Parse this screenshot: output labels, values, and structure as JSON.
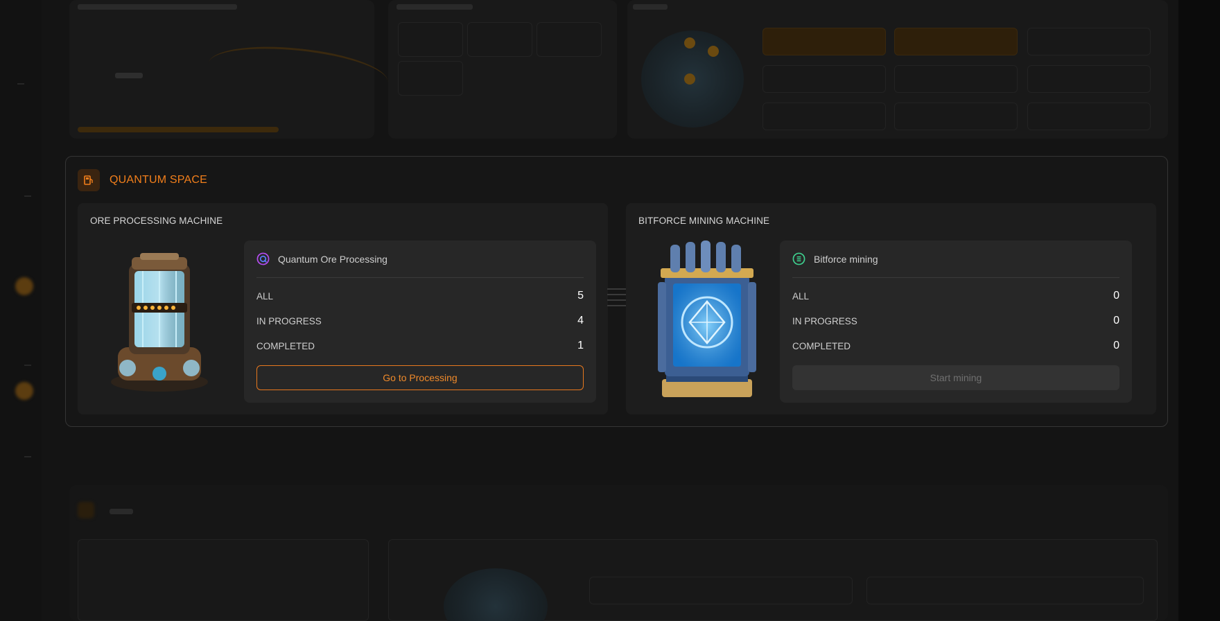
{
  "quantum_space": {
    "title": "QUANTUM SPACE",
    "header_icon": "fuel-station-icon",
    "accent_color": "#f27f1b"
  },
  "ore_machine": {
    "title": "ORE PROCESSING MACHINE",
    "process_name": "Quantum Ore Processing",
    "process_icon": "quantum-q-icon",
    "stats": [
      {
        "label": "ALL",
        "value": "5"
      },
      {
        "label": "IN PROGRESS",
        "value": "4"
      },
      {
        "label": "COMPLETED",
        "value": "1"
      }
    ],
    "button_label": "Go to Processing"
  },
  "bitforce_machine": {
    "title": "BITFORCE MINING MACHINE",
    "process_name": "Bitforce mining",
    "process_icon": "bitforce-coin-icon",
    "stats": [
      {
        "label": "ALL",
        "value": "0"
      },
      {
        "label": "IN PROGRESS",
        "value": "0"
      },
      {
        "label": "COMPLETED",
        "value": "0"
      }
    ],
    "button_label": "Start mining"
  },
  "colors": {
    "background": "#0f0f0f",
    "card": "#1d1d1d",
    "stats_box": "#272727",
    "button_disabled": "#333333"
  }
}
